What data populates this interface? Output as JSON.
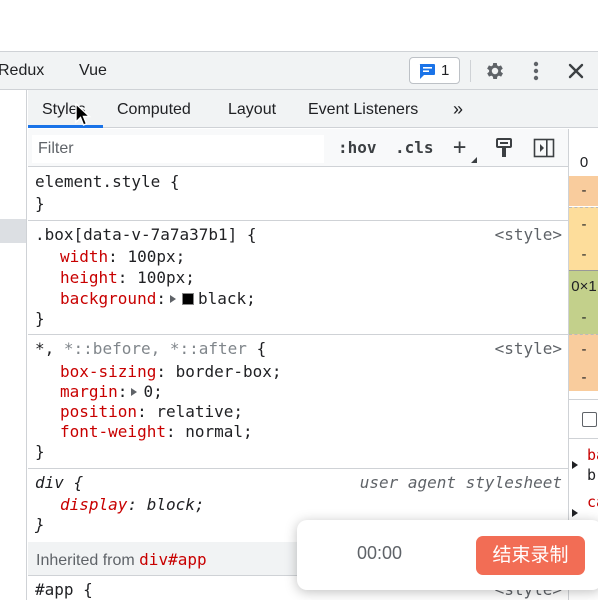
{
  "devtools": {
    "panel_tabs": [
      "Redux",
      "Vue"
    ],
    "issues_count": "1"
  },
  "styles": {
    "subtabs": [
      "Styles",
      "Computed",
      "Layout",
      "Event Listeners",
      "»"
    ],
    "filter_placeholder": "Filter",
    "tools": {
      "hov": ":hov",
      "cls": ".cls",
      "add": "+"
    },
    "rules": {
      "element_style": {
        "selector": "element.style {",
        "close": "}"
      },
      "box": {
        "selector": ".box[data-v-7a7a37b1] {",
        "source": "<style>",
        "width_prop": "width",
        "width_val": "100px",
        "height_prop": "height",
        "height_val": "100px",
        "background_prop": "background",
        "background_val": "black",
        "close": "}"
      },
      "universal": {
        "selector_a": "*,",
        "selector_b": "*::before, *::after",
        "selector_c": "{",
        "source": "<style>",
        "box_sizing_prop": "box-sizing",
        "box_sizing_val": "border-box",
        "margin_prop": "margin",
        "margin_val": "0",
        "position_prop": "position",
        "position_val": "relative",
        "font_weight_prop": "font-weight",
        "font_weight_val": "normal",
        "close": "}"
      },
      "div": {
        "selector": "div {",
        "source": "user agent stylesheet",
        "display_prop": "display",
        "display_val": "block",
        "close": "}"
      }
    },
    "inherited": {
      "label": "Inherited from",
      "link": "div#app"
    },
    "app_rule": {
      "selector": "#app {",
      "source": "<style>"
    }
  },
  "box_model": {
    "values": [
      "0",
      "-",
      "-",
      "-",
      "0×1",
      "-",
      "-",
      "-"
    ],
    "colors": [
      "#ffffff",
      "#f9cc9d",
      "#fddd9b",
      "#fddd9b",
      "#c3d08b",
      "#c3d08b",
      "#f9cc9d",
      "#f9cc9d"
    ],
    "computed": [
      {
        "name": "ba",
        "value": "b"
      },
      {
        "name": "ca",
        "value": ""
      }
    ]
  },
  "recorder": {
    "time": "00:00",
    "stop_label": "结束录制"
  }
}
